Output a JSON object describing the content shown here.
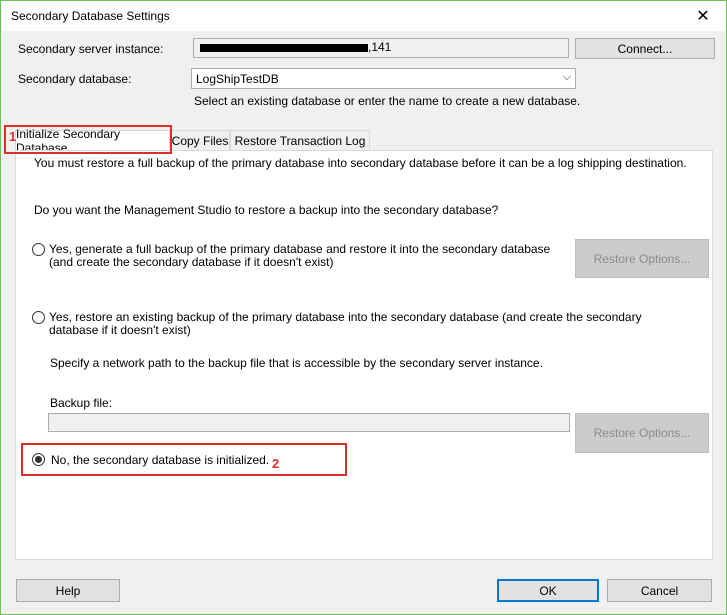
{
  "window": {
    "title": "Secondary Database Settings",
    "close_glyph": "✕"
  },
  "server": {
    "label": "Secondary server instance:",
    "value_visible": ",141",
    "connect_label": "Connect..."
  },
  "database": {
    "label": "Secondary database:",
    "value": "LogShipTestDB",
    "hint": "Select an existing database or enter the name to create a new database."
  },
  "tabs": [
    {
      "label": "Initialize Secondary Database",
      "active": true
    },
    {
      "label": "Copy Files",
      "active": false
    },
    {
      "label": "Restore Transaction Log",
      "active": false
    }
  ],
  "panel": {
    "intro": "You must restore a full backup of the primary database into secondary database before it can be a log shipping destination.",
    "question": "Do you want the Management Studio to restore a backup into the secondary database?",
    "option1": "Yes, generate a full backup of the primary database and restore it into the secondary database (and create the secondary database if it doesn't exist)",
    "option2": "Yes, restore an existing backup of the primary database into the secondary database (and create the secondary database if it doesn't exist)",
    "network_hint": "Specify a network path to the backup file that is accessible by the secondary server instance.",
    "backup_label": "Backup file:",
    "backup_value": "",
    "option3": "No, the secondary database is initialized.",
    "restore_options_label": "Restore Options..."
  },
  "annotations": {
    "marker1": "1",
    "marker2": "2",
    "color": "#d9302c"
  },
  "footer": {
    "help": "Help",
    "ok": "OK",
    "cancel": "Cancel"
  }
}
